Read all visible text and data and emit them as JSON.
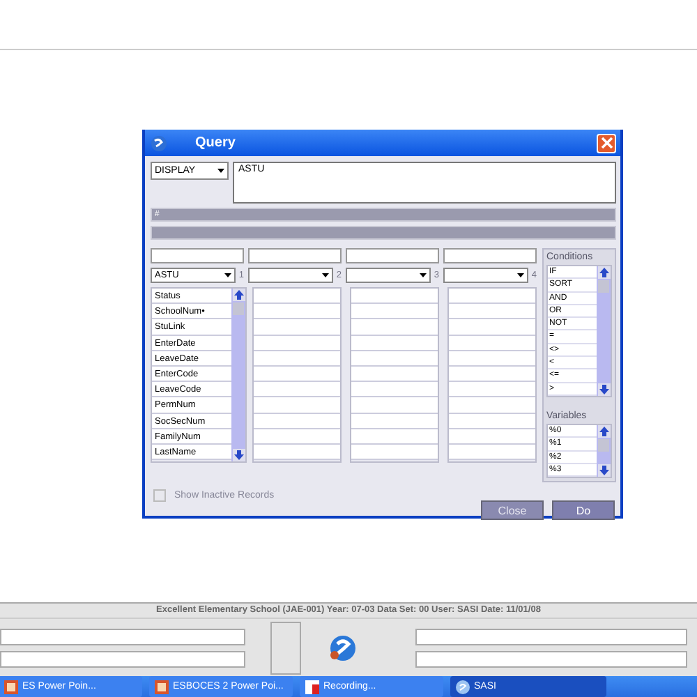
{
  "window": {
    "title": "Query"
  },
  "display": {
    "value": "DISPLAY",
    "query": "ASTU"
  },
  "header_bar": "#",
  "columns": [
    {
      "table": "ASTU",
      "number": "1",
      "fields": [
        "Status",
        "SchoolNum•",
        "StuLink",
        "EnterDate",
        "LeaveDate",
        "EnterCode",
        "LeaveCode",
        "PermNum",
        "SocSecNum",
        "FamilyNum",
        "LastName"
      ]
    },
    {
      "number": "2"
    },
    {
      "number": "3"
    },
    {
      "number": "4"
    }
  ],
  "conditions": {
    "label": "Conditions",
    "items": [
      "IF",
      "SORT",
      "AND",
      "OR",
      "NOT",
      "=",
      "<>",
      "<",
      "<=",
      ">"
    ]
  },
  "variables": {
    "label": "Variables",
    "items": [
      "%0",
      "%1",
      "%2",
      "%3"
    ]
  },
  "show_inactive": {
    "label": "Show Inactive Records",
    "checked": false
  },
  "buttons": [
    {
      "label": "Close",
      "disabled": true
    },
    {
      "label": "Do",
      "disabled": false
    }
  ],
  "status_bar": "Excellent Elementary School (JAE-001)  Year: 07-03 Data Set: 00  User: SASI  Date: 11/01/08",
  "taskbar": [
    {
      "label": "ES Power Poin...",
      "selected": false,
      "kind": "ppt"
    },
    {
      "label": "ESBOCES 2 Power Poi...",
      "selected": false,
      "kind": "ppt"
    },
    {
      "label": "Recording...",
      "selected": false,
      "kind": "rec"
    },
    {
      "label": "SASI",
      "selected": true,
      "kind": "sasi"
    }
  ]
}
